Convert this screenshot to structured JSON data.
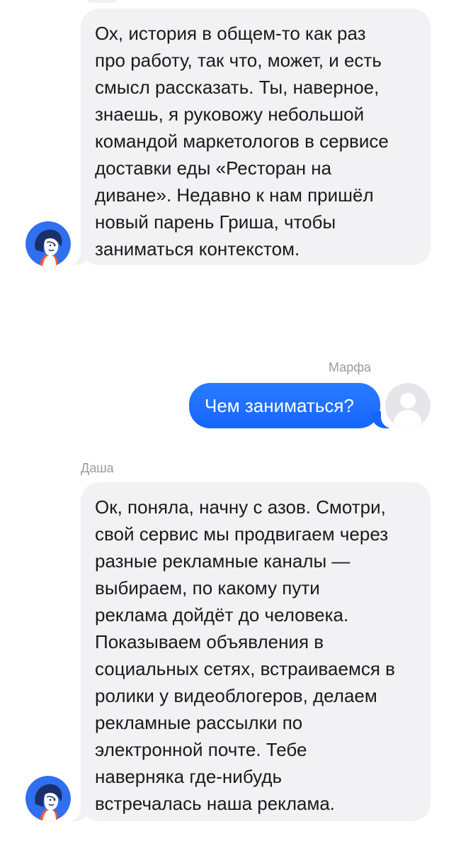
{
  "messages": [
    {
      "sender": "",
      "direction": "incoming",
      "lines": [
        "Ох, история в общем-то как раз",
        "про работу, так что, может, и есть",
        "смысл рассказать. Ты, наверное,",
        "знаешь, я руковожу небольшой",
        "командой маркетологов в сервисе",
        "доставки еды «Ресторан на",
        "диване». Недавно к нам пришёл",
        "новый парень Гриша, чтобы",
        "заниматься контекстом."
      ],
      "avatar_icon": "assistant-avatar-icon"
    },
    {
      "sender": "Марфа",
      "direction": "outgoing",
      "lines": [
        "Чем заниматься?"
      ],
      "avatar_icon": "user-placeholder-icon"
    },
    {
      "sender": "Даша",
      "direction": "incoming",
      "lines": [
        "Ок, поняла, начну с азов. Смотри,",
        "свой сервис мы продвигаем через",
        "разные рекламные каналы —",
        "выбираем, по какому пути",
        "реклама дойдёт до человека.",
        "Показываем объявления в",
        "социальных сетях, встраиваемся в",
        "ролики у видеоблогеров, делаем",
        "рекламные рассылки по",
        "электронной почте. Тебе",
        "наверняка где-нибудь",
        "встречалась наша реклама."
      ],
      "avatar_icon": "assistant-avatar-icon"
    }
  ],
  "colors": {
    "incoming_bubble": "#f2f2f5",
    "outgoing_bubble": "#1565ff",
    "sender_name": "#9a9aa2",
    "avatar_blue": "#2f6ff0"
  }
}
